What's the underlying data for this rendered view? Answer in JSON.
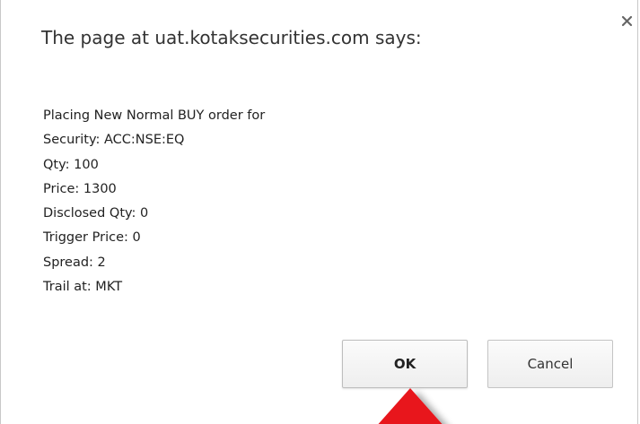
{
  "dialog": {
    "title": "The page at uat.kotaksecurities.com says:",
    "message_lines": [
      "Placing New Normal BUY order for",
      "Security: ACC:NSE:EQ",
      "Qty: 100",
      "Price: 1300",
      "Disclosed Qty: 0",
      "Trigger Price: 0",
      "Spread: 2",
      "Trail at: MKT"
    ],
    "ok_label": "OK",
    "cancel_label": "Cancel",
    "close_icon": "close-icon"
  },
  "annotation": {
    "arrow_icon": "red-arrow-up-icon",
    "arrow_color": "#e8141c"
  }
}
